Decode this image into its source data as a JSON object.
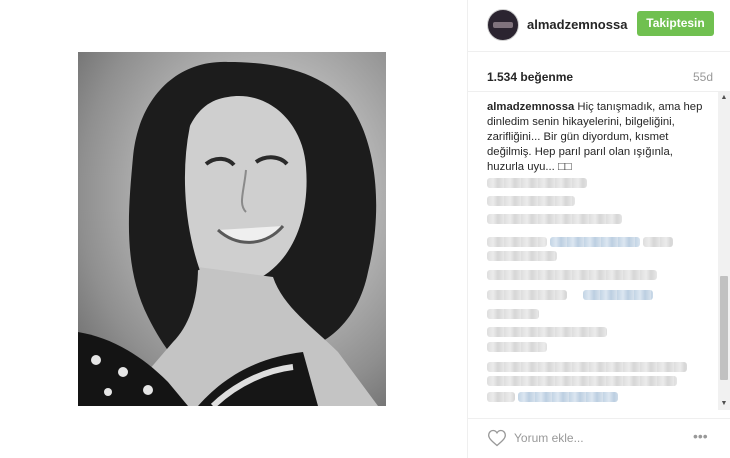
{
  "post": {
    "image_alt": "black-and-white portrait of a smiling woman",
    "username": "almadzemnossa",
    "follow_label": "Takiptesin",
    "likes": "1.534 beğenme",
    "time_ago": "55d",
    "caption": {
      "user": "almadzemnossa",
      "text": "Hiç tanışmadık, ama hep dinledim senin hikayelerini, bilgeliğini, zarifliğini... Bir gün diyordum, kısmet değilmiş. Hep parıl parıl olan ışığınla, huzurla uyu... □□"
    },
    "comment_placeholder": "Yorum ekle...",
    "more_label": "•••"
  },
  "icons": {
    "heart": "heart-icon",
    "more": "more-options-icon",
    "scroll_up": "▲",
    "scroll_down": "▼"
  },
  "colors": {
    "follow_button": "#70c050",
    "muted_text": "#999999",
    "divider": "#efefef"
  }
}
